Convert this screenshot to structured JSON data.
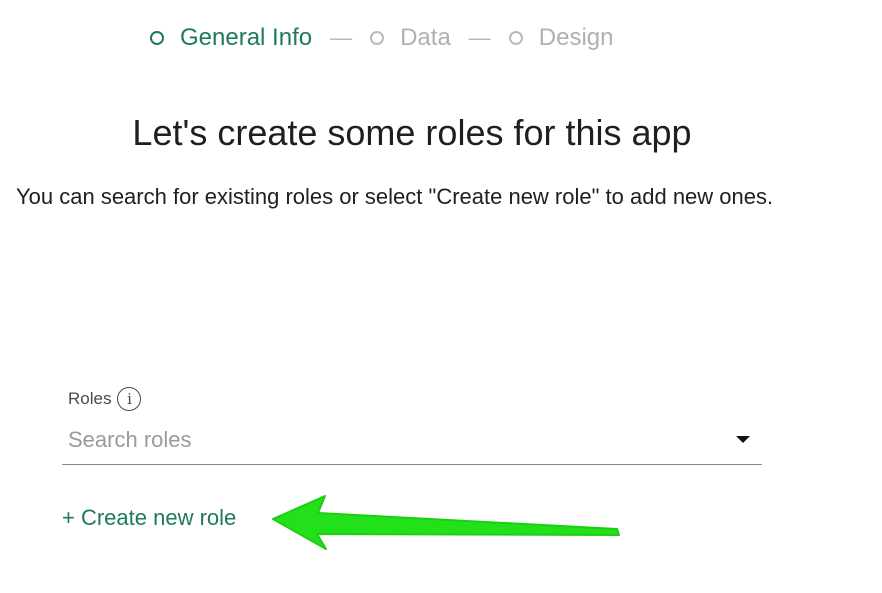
{
  "stepper": {
    "steps": [
      {
        "label": "General Info",
        "active": true
      },
      {
        "label": "Data",
        "active": false
      },
      {
        "label": "Design",
        "active": false
      }
    ],
    "separator": "—"
  },
  "page": {
    "title": "Let's create some roles for this app",
    "description": "You can search for existing roles or select \"Create new role\" to add new ones."
  },
  "roles": {
    "label": "Roles",
    "info_glyph": "i",
    "placeholder": "Search roles",
    "value": ""
  },
  "actions": {
    "create_new_role": "+ Create new role"
  },
  "colors": {
    "accent": "#1f7a5a",
    "inactive": "#b0b0b0",
    "annotation_arrow": "#22e01a"
  },
  "icons": {
    "info": "info-icon",
    "dropdown": "chevron-down-icon",
    "annotation": "arrow-left-icon"
  }
}
